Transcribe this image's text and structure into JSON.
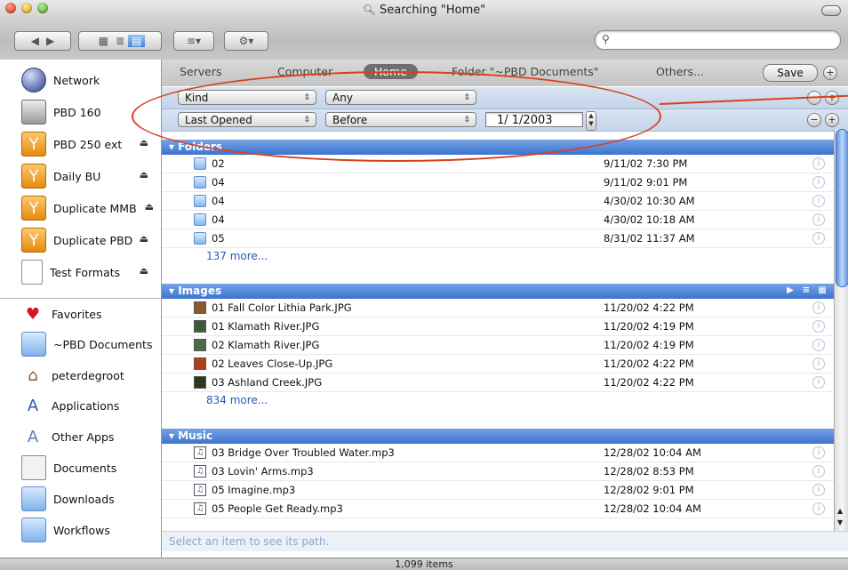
{
  "window": {
    "title": "Searching \"Home\"",
    "status": "1,099 items"
  },
  "toolbar": {
    "back_label": "◀",
    "forward_label": "▶",
    "view_icon": "▦",
    "list_icon": "≣",
    "column_icon": "▤",
    "arrange_icon": "≡▾",
    "action_icon": "⚙▾",
    "search_placeholder": ""
  },
  "sidebar": {
    "devices": [
      {
        "label": "Network",
        "icon": "network-icon"
      },
      {
        "label": "PBD 160",
        "icon": "hard-drive-icon"
      },
      {
        "label": "PBD 250 ext",
        "icon": "firewire-drive-icon",
        "eject": true
      },
      {
        "label": "Daily BU",
        "icon": "firewire-drive-icon",
        "eject": true
      },
      {
        "label": "Duplicate MMB",
        "icon": "firewire-drive-icon",
        "eject": true
      },
      {
        "label": "Duplicate PBD",
        "icon": "firewire-drive-icon",
        "eject": true
      },
      {
        "label": "Test Formats",
        "icon": "document-icon",
        "eject": true
      }
    ],
    "places": [
      {
        "label": "Favorites",
        "icon": "heart-icon"
      },
      {
        "label": "~PBD Documents",
        "icon": "folder-icon"
      },
      {
        "label": "peterdegroot",
        "icon": "home-icon"
      },
      {
        "label": "Applications",
        "icon": "applications-icon"
      },
      {
        "label": "Other Apps",
        "icon": "other-apps-icon"
      },
      {
        "label": "Documents",
        "icon": "documents-icon"
      },
      {
        "label": "Downloads",
        "icon": "folder-icon"
      },
      {
        "label": "Workflows",
        "icon": "folder-icon"
      }
    ]
  },
  "scope": {
    "tabs": [
      "Servers",
      "Computer",
      "Home",
      "Folder \"~PBD Documents\"",
      "Others..."
    ],
    "selected": "Home",
    "save_label": "Save"
  },
  "criteria": [
    {
      "attribute": "Kind",
      "operator": "Any"
    },
    {
      "attribute": "Last Opened",
      "operator": "Before",
      "value": "1/  1/2003"
    }
  ],
  "groups": {
    "folders": {
      "title": "Folders",
      "rows": [
        {
          "name": "02",
          "date": "9/11/02 7:30 PM"
        },
        {
          "name": "04",
          "date": "9/11/02 9:01 PM"
        },
        {
          "name": "04",
          "date": "4/30/02 10:30 AM"
        },
        {
          "name": "04",
          "date": "4/30/02 10:18 AM"
        },
        {
          "name": "05",
          "date": "8/31/02 11:37 AM"
        }
      ],
      "more": "137 more..."
    },
    "images": {
      "title": "Images",
      "rows": [
        {
          "name": "01 Fall Color Lithia Park.JPG",
          "date": "11/20/02 4:22 PM",
          "thumb": "#8a5a2a"
        },
        {
          "name": "01 Klamath River.JPG",
          "date": "11/20/02 4:19 PM",
          "thumb": "#3a5a3a"
        },
        {
          "name": "02 Klamath River.JPG",
          "date": "11/20/02 4:19 PM",
          "thumb": "#4a6a4a"
        },
        {
          "name": "02 Leaves Close-Up.JPG",
          "date": "11/20/02 4:22 PM",
          "thumb": "#b0401a"
        },
        {
          "name": "03 Ashland Creek.JPG",
          "date": "11/20/02 4:22 PM",
          "thumb": "#2a3a1a"
        }
      ],
      "more": "834 more..."
    },
    "music": {
      "title": "Music",
      "rows": [
        {
          "name": "03 Bridge Over Troubled Water.mp3",
          "date": "12/28/02 10:04 AM"
        },
        {
          "name": "03 Lovin' Arms.mp3",
          "date": "12/28/02 8:53 PM"
        },
        {
          "name": "05 Imagine.mp3",
          "date": "12/28/02 9:01 PM"
        },
        {
          "name": "05 People Get Ready.mp3",
          "date": "12/28/02 10:04 AM"
        }
      ]
    }
  },
  "pathbar": "Select an item to see its path.",
  "colors": {
    "group_header": "#4a82d8",
    "annotation": "#d8401d"
  }
}
